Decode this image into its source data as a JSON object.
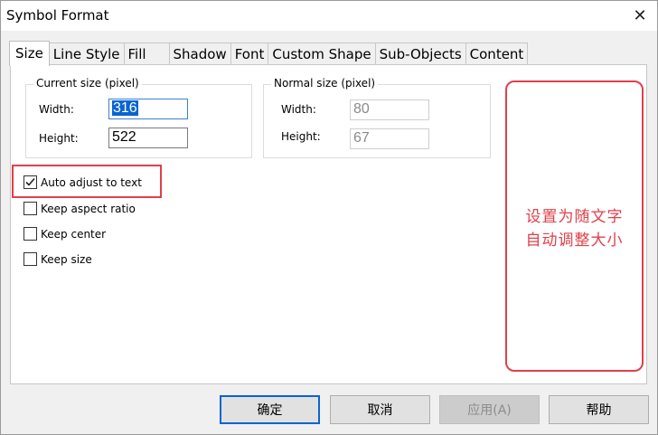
{
  "window": {
    "title": "Symbol Format",
    "close_glyph": "✕"
  },
  "tabs": [
    {
      "label": "Size",
      "active": true
    },
    {
      "label": "Line Style",
      "active": false
    },
    {
      "label": "Fill",
      "active": false
    },
    {
      "label": "Shadow",
      "active": false
    },
    {
      "label": "Font",
      "active": false
    },
    {
      "label": "Custom Shape",
      "active": false
    },
    {
      "label": "Sub-Objects",
      "active": false
    },
    {
      "label": "Content",
      "active": false
    }
  ],
  "current_size": {
    "legend": "Current size (pixel)",
    "width_label": "Width:",
    "width_value": "316",
    "height_label": "Height:",
    "height_value": "522"
  },
  "normal_size": {
    "legend": "Normal size (pixel)",
    "width_label": "Width:",
    "width_value": "80",
    "height_label": "Height:",
    "height_value": "67"
  },
  "options": [
    {
      "label": "Auto adjust to text",
      "checked": true
    },
    {
      "label": "Keep aspect ratio",
      "checked": false
    },
    {
      "label": "Keep center",
      "checked": false
    },
    {
      "label": "Keep size",
      "checked": false
    }
  ],
  "annotation": {
    "line1": "设置为随文字",
    "line2": "自动调整大小",
    "color": "#e0404a"
  },
  "buttons": {
    "ok": "确定",
    "cancel": "取消",
    "apply": "应用(A)",
    "help": "帮助"
  }
}
